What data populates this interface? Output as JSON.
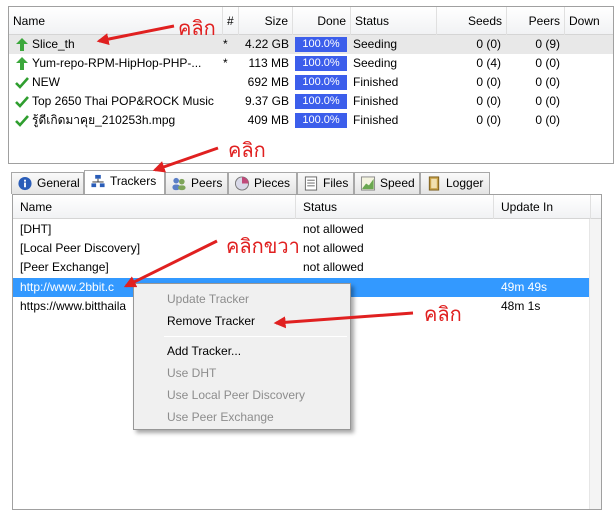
{
  "torrents": {
    "columns": [
      "Name",
      "#",
      "Size",
      "Done",
      "Status",
      "Seeds",
      "Peers",
      "Down"
    ],
    "rows": [
      {
        "name": "Slice_th",
        "queue": "*",
        "size": "4.22 GB",
        "done": "100.0%",
        "status": "Seeding",
        "seeds": "0 (0)",
        "peers": "0 (9)",
        "icon": "seeding-arrow-icon"
      },
      {
        "name": "Yum-repo-RPM-HipHop-PHP-...",
        "queue": "*",
        "size": "113 MB",
        "done": "100.0%",
        "status": "Seeding",
        "seeds": "0 (4)",
        "peers": "0 (0)",
        "icon": "seeding-arrow-icon"
      },
      {
        "name": "NEW",
        "queue": "",
        "size": "692 MB",
        "done": "100.0%",
        "status": "Finished",
        "seeds": "0 (0)",
        "peers": "0 (0)",
        "icon": "finished-check-icon"
      },
      {
        "name": "Top 2650 Thai POP&ROCK Music",
        "queue": "",
        "size": "9.37 GB",
        "done": "100.0%",
        "status": "Finished",
        "seeds": "0 (0)",
        "peers": "0 (0)",
        "icon": "finished-check-icon"
      },
      {
        "name": "รู้ดีเกิดมาคุย_210253h.mpg",
        "queue": "",
        "size": "409 MB",
        "done": "100.0%",
        "status": "Finished",
        "seeds": "0 (0)",
        "peers": "0 (0)",
        "icon": "finished-check-icon"
      }
    ]
  },
  "tabs": [
    {
      "label": "General",
      "icon": "info-icon"
    },
    {
      "label": "Trackers",
      "icon": "network-icon"
    },
    {
      "label": "Peers",
      "icon": "peers-icon"
    },
    {
      "label": "Pieces",
      "icon": "pieces-icon"
    },
    {
      "label": "Files",
      "icon": "files-icon"
    },
    {
      "label": "Speed",
      "icon": "speed-chart-icon"
    },
    {
      "label": "Logger",
      "icon": "logger-icon"
    }
  ],
  "trackers": {
    "columns": [
      "Name",
      "Status",
      "Update In"
    ],
    "rows": [
      {
        "name": "[DHT]",
        "status": "not allowed",
        "update_in": ""
      },
      {
        "name": "[Local Peer Discovery]",
        "status": "not allowed",
        "update_in": ""
      },
      {
        "name": "[Peer Exchange]",
        "status": "not allowed",
        "update_in": ""
      },
      {
        "name": "http://www.2bbit.c",
        "status": "",
        "update_in": "49m 49s"
      },
      {
        "name": "https://www.bitthaila",
        "status": "",
        "update_in": "48m 1s"
      }
    ]
  },
  "context_menu": {
    "items": [
      {
        "label": "Update Tracker",
        "enabled": false
      },
      {
        "label": "Remove Tracker",
        "enabled": true
      },
      {
        "label": "Add Tracker...",
        "enabled": true
      },
      {
        "label": "Use DHT",
        "enabled": false
      },
      {
        "label": "Use Local Peer Discovery",
        "enabled": false
      },
      {
        "label": "Use Peer Exchange",
        "enabled": false
      }
    ]
  },
  "annotations": {
    "click_1": "คลิก",
    "click_2": "คลิก",
    "right_click": "คลิกขวา",
    "click_3": "คลิก"
  },
  "colors": {
    "done_bar": "#3c5eeb",
    "selection": "#3399ff",
    "annotation": "#e02020"
  }
}
